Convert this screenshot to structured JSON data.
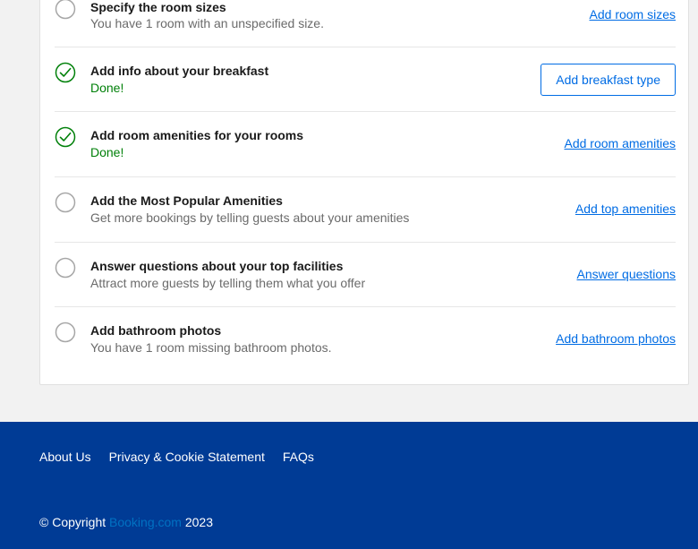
{
  "checklist": {
    "items": [
      {
        "title": "Specify the room sizes",
        "subtitle": "You have 1 room with an unspecified size.",
        "status": "pending",
        "action": "Add room sizes",
        "action_style": "link"
      },
      {
        "title": "Add info about your breakfast",
        "subtitle": "Done!",
        "status": "done",
        "action": "Add breakfast type",
        "action_style": "button"
      },
      {
        "title": "Add room amenities for your rooms",
        "subtitle": "Done!",
        "status": "done",
        "action": "Add room amenities",
        "action_style": "link"
      },
      {
        "title": "Add the Most Popular Amenities",
        "subtitle": "Get more bookings by telling guests about your amenities",
        "status": "pending",
        "action": "Add top amenities",
        "action_style": "link"
      },
      {
        "title": "Answer questions about your top facilities",
        "subtitle": "Attract more guests by telling them what you offer",
        "status": "pending",
        "action": "Answer questions",
        "action_style": "link"
      },
      {
        "title": "Add bathroom photos",
        "subtitle": "You have 1 room missing bathroom photos.",
        "status": "pending",
        "action": "Add bathroom photos",
        "action_style": "link"
      }
    ]
  },
  "footer": {
    "links": [
      "About Us",
      "Privacy & Cookie Statement",
      "FAQs"
    ],
    "copyright_prefix": "© Copyright",
    "brand": "Booking.com",
    "year": "2023"
  },
  "colors": {
    "accent": "#006ce4",
    "done_green": "#008009",
    "footer_bg": "#003b95"
  }
}
